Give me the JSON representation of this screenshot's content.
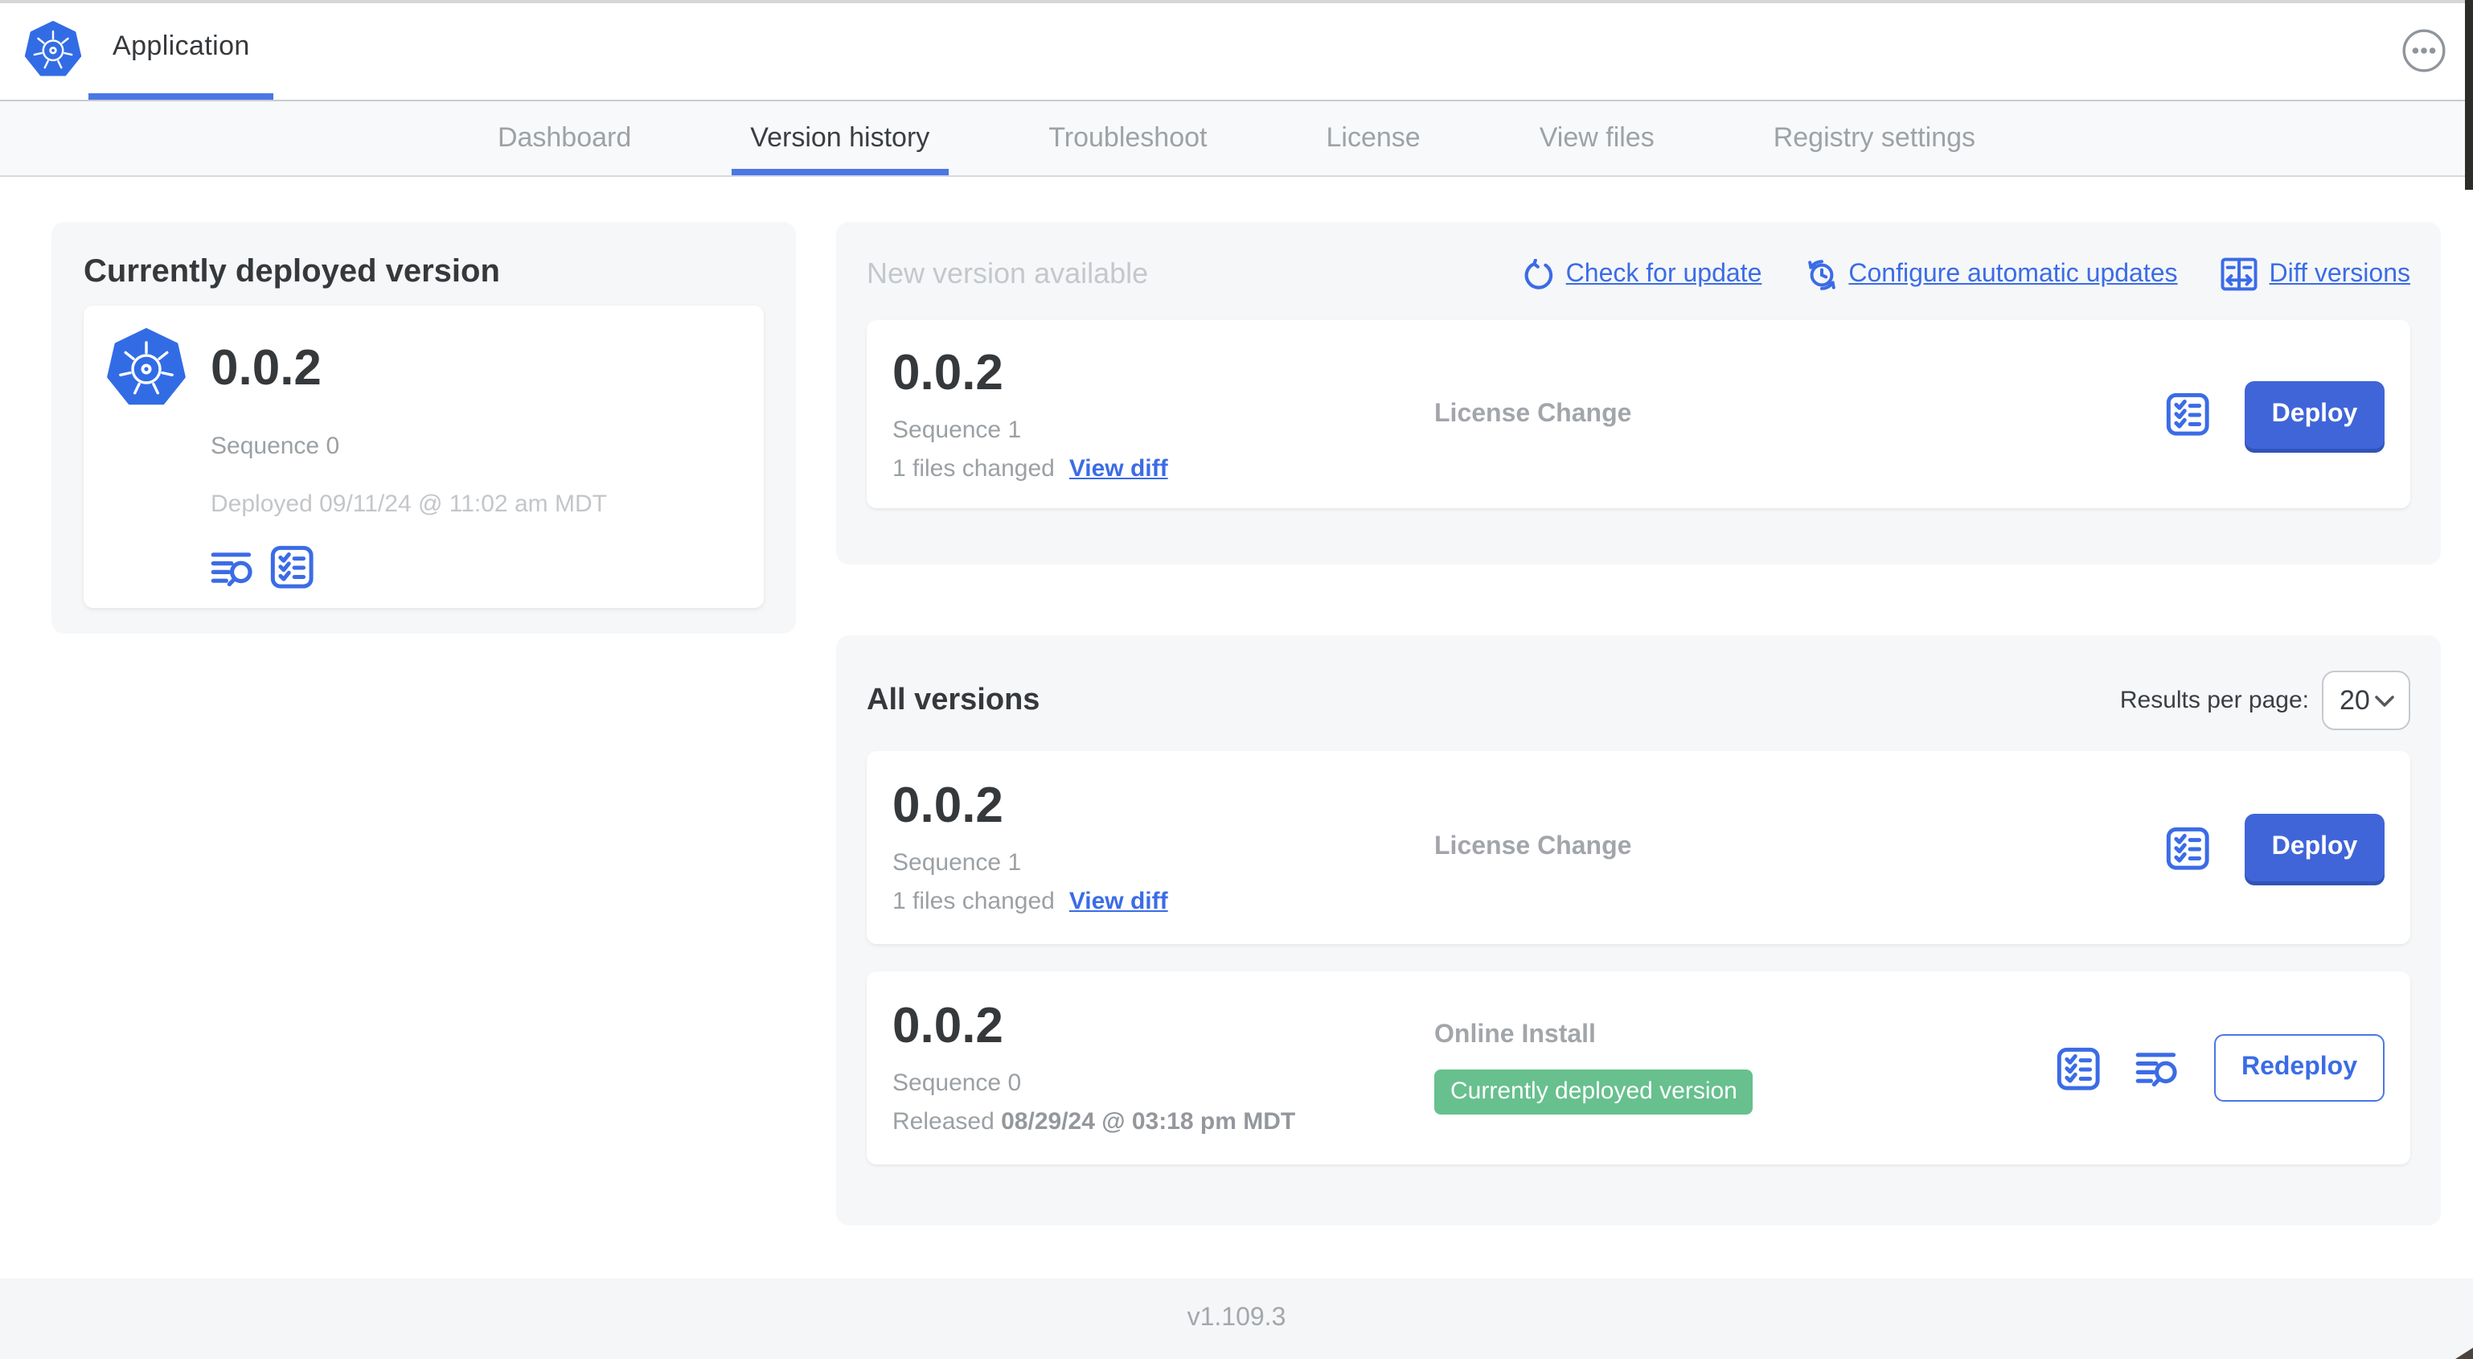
{
  "header": {
    "app_name": "Application"
  },
  "nav": {
    "tabs": [
      {
        "label": "Dashboard",
        "active": false
      },
      {
        "label": "Version history",
        "active": true
      },
      {
        "label": "Troubleshoot",
        "active": false
      },
      {
        "label": "License",
        "active": false
      },
      {
        "label": "View files",
        "active": false
      },
      {
        "label": "Registry settings",
        "active": false
      }
    ]
  },
  "deployed": {
    "title": "Currently deployed version",
    "version": "0.0.2",
    "sequence": "Sequence 0",
    "deployed_at": "Deployed 09/11/24 @ 11:02 am MDT"
  },
  "new_version": {
    "title": "New version available",
    "links": [
      {
        "label": "Check for update",
        "icon": "refresh-icon"
      },
      {
        "label": "Configure automatic updates",
        "icon": "schedule-icon"
      },
      {
        "label": "Diff versions",
        "icon": "diff-icon"
      }
    ],
    "row": {
      "version": "0.0.2",
      "sequence": "Sequence 1",
      "files_changed": "1 files changed",
      "view_diff_label": "View diff",
      "source": "License Change",
      "action_label": "Deploy"
    }
  },
  "all_versions": {
    "title": "All versions",
    "results_label": "Results per page:",
    "results_value": "20",
    "rows": [
      {
        "version": "0.0.2",
        "sequence": "Sequence 1",
        "files_changed": "1 files changed",
        "view_diff_label": "View diff",
        "source": "License Change",
        "action_label": "Deploy"
      },
      {
        "version": "0.0.2",
        "sequence": "Sequence 0",
        "released_prefix": "Released",
        "released_date": "08/29/24 @ 03:18 pm MDT",
        "source": "Online Install",
        "badge": "Currently deployed version",
        "action_label": "Redeploy"
      }
    ]
  },
  "footer": {
    "version": "v1.109.3"
  },
  "colors": {
    "link_blue": "#3b6ce6",
    "button_blue": "#4065d8",
    "badge_green": "#67c08e",
    "tab_underline_blue": "#4a77e5",
    "k8s_logo_blue": "#326ce5",
    "panel_gray": "#f6f7f9"
  }
}
